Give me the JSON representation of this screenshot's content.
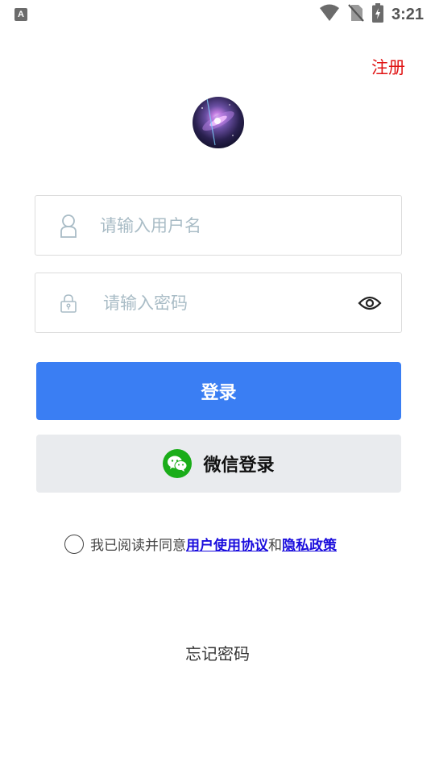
{
  "status_bar": {
    "notification_icon": "A",
    "time": "3:21",
    "icons": [
      "wifi-icon",
      "no-sim-icon",
      "battery-charging-icon"
    ]
  },
  "header": {
    "register_label": "注册"
  },
  "avatar": {
    "icon": "galaxy-avatar"
  },
  "form": {
    "username": {
      "placeholder": "请输入用户名",
      "value": "",
      "icon": "user-icon"
    },
    "password": {
      "placeholder": "请输入密码",
      "value": "",
      "icon": "lock-icon",
      "toggle_icon": "eye-icon"
    }
  },
  "buttons": {
    "login_label": "登录",
    "wechat_login_label": "微信登录"
  },
  "agreement": {
    "prefix": "我已阅读并同意",
    "user_agreement": "用户使用协议",
    "conjunction": "和",
    "privacy_policy": "隐私政策",
    "checked": false
  },
  "footer": {
    "forgot_password_label": "忘记密码"
  },
  "colors": {
    "primary": "#3a7ef3",
    "register": "#e01414",
    "link": "#1a0ddd",
    "wechat_green": "#1aad19",
    "secondary_button": "#e9ebee",
    "placeholder": "#a9bcc6"
  }
}
